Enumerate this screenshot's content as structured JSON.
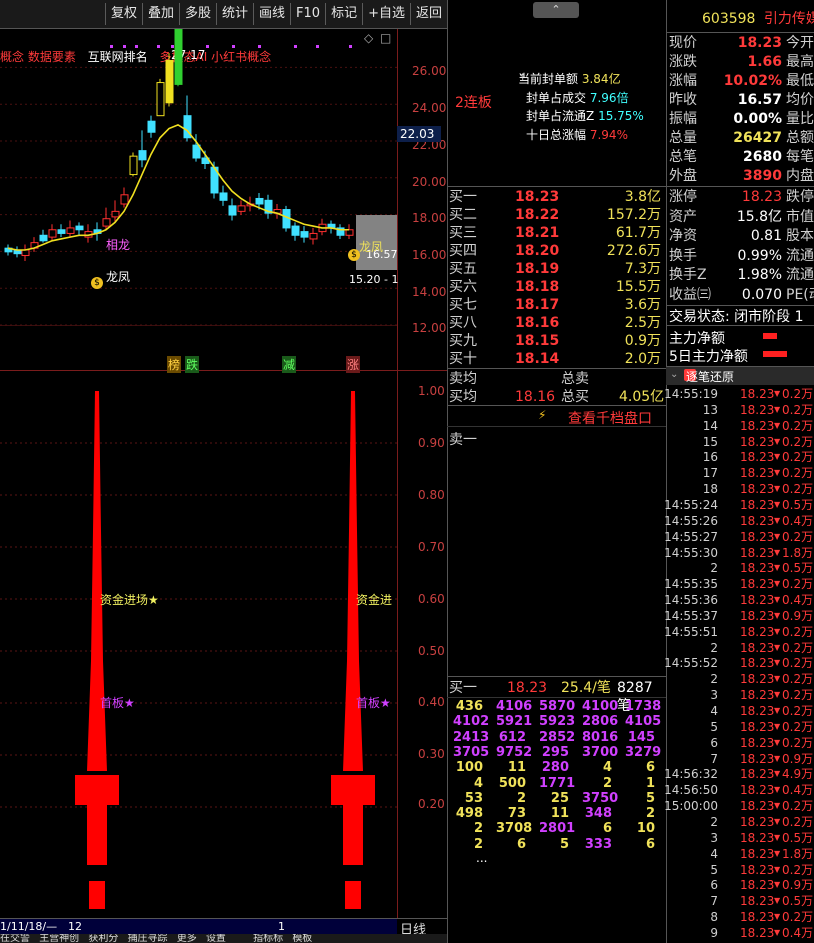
{
  "toolbar": {
    "buttons": [
      "复权",
      "叠加",
      "多股",
      "统计",
      "画线",
      "F10",
      "标记",
      "+自选",
      "返回"
    ]
  },
  "kline": {
    "header_left": "概念 数据要素",
    "header_mid": "互联网排名",
    "header_right": "多模态AI 小红书概念",
    "max_label": "27.17",
    "yticks": [
      "26.00",
      "24.00",
      "22.00",
      "20.00",
      "18.00",
      "16.00",
      "14.00",
      "12.00"
    ],
    "current_price_box": "22.03",
    "low_label": "15.20 - 1",
    "right_label": "16.57",
    "annotation_longfeng": "龙凤",
    "annotation_xianghu": "相龙",
    "annotation_longfeng2": "龙凤",
    "tags": [
      "榜",
      "跌",
      "减",
      "涨"
    ]
  },
  "indicator": {
    "yticks": [
      "1.00",
      "0.90",
      "0.80",
      "0.70",
      "0.60",
      "0.50",
      "0.40",
      "0.30",
      "0.20"
    ],
    "label_fund": "资金进场★",
    "label_fund2": "资金进",
    "label_first": "首板★",
    "label_first2": "首板★"
  },
  "bottom": {
    "date": "1/11/18/—",
    "marker12": "12",
    "marker1": "1",
    "day_label": "日线",
    "tabs": [
      "在交警",
      "主营神创",
      "获利分",
      "捕庄寻踪",
      "更多",
      "设置",
      "指标标",
      "模板"
    ]
  },
  "board": {
    "lianban": "2连板",
    "seal_amount_label": "当前封单额",
    "seal_amount": "3.84亿",
    "seal_ratio_label": "封单占成交",
    "seal_ratio": "7.96倍",
    "seal_float_label": "封单占流通Z",
    "seal_float": "15.75%",
    "ten_day_label": "十日总涨幅",
    "ten_day": "7.94%"
  },
  "stock": {
    "code": "603598",
    "name": "引力传媒",
    "fields": [
      {
        "l": "现价",
        "v": "18.23",
        "c": "r",
        "t": "今开"
      },
      {
        "l": "涨跌",
        "v": "1.66",
        "c": "r",
        "t": "最高"
      },
      {
        "l": "涨幅",
        "v": "10.02%",
        "c": "r",
        "t": "最低"
      },
      {
        "l": "昨收",
        "v": "16.57",
        "c": "w",
        "t": "均价"
      },
      {
        "l": "振幅",
        "v": "0.00%",
        "c": "w",
        "t": "量比"
      },
      {
        "l": "总量",
        "v": "26427",
        "c": "y",
        "t": "总额"
      },
      {
        "l": "总笔",
        "v": "2680",
        "c": "w",
        "t": "每笔"
      },
      {
        "l": "外盘",
        "v": "3890",
        "c": "r",
        "t": "内盘"
      }
    ],
    "fields2": [
      {
        "l": "涨停",
        "v": "18.23",
        "c": "r",
        "t": "跌停"
      },
      {
        "l": "资产",
        "v": "15.8亿",
        "c": "w",
        "t": "市值"
      },
      {
        "l": "净资",
        "v": "0.81",
        "c": "w",
        "t": "股本"
      },
      {
        "l": "换手",
        "v": "0.99%",
        "c": "w",
        "t": "流通"
      },
      {
        "l": "换手Z",
        "v": "1.98%",
        "c": "w",
        "t": "流通"
      },
      {
        "l": "收益㈢",
        "v": "0.070",
        "c": "w",
        "t": "PE(动"
      }
    ],
    "trade_status": "交易状态: 闭市阶段 1",
    "main_net": "主力净额",
    "main_net5": "5日主力净额"
  },
  "orderbook": {
    "buys": [
      {
        "l": "买一",
        "p": "18.23",
        "v": "3.8亿"
      },
      {
        "l": "买二",
        "p": "18.22",
        "v": "157.2万"
      },
      {
        "l": "买三",
        "p": "18.21",
        "v": "61.7万"
      },
      {
        "l": "买四",
        "p": "18.20",
        "v": "272.6万"
      },
      {
        "l": "买五",
        "p": "18.19",
        "v": "7.3万"
      },
      {
        "l": "买六",
        "p": "18.18",
        "v": "15.5万"
      },
      {
        "l": "买七",
        "p": "18.17",
        "v": "3.6万"
      },
      {
        "l": "买八",
        "p": "18.16",
        "v": "2.5万"
      },
      {
        "l": "买九",
        "p": "18.15",
        "v": "0.9万"
      },
      {
        "l": "买十",
        "p": "18.14",
        "v": "2.0万"
      }
    ],
    "sell_avg_label": "卖均",
    "sell_total_label": "总卖",
    "buy_avg_label": "买均",
    "buy_avg": "18.16",
    "buy_total_label": "总买",
    "buy_total": "4.05亿",
    "view_depth": "查看千档盘口",
    "sell1_label": "卖一",
    "queue_label": "买一",
    "queue_price": "18.23",
    "queue_avg": "25.4/笔",
    "queue_count": "8287笔",
    "queue": [
      [
        "436",
        "4106",
        "5870",
        "4100",
        "1738"
      ],
      [
        "4102",
        "5921",
        "5923",
        "2806",
        "4105"
      ],
      [
        "2413",
        "612",
        "2852",
        "8016",
        "145"
      ],
      [
        "3705",
        "9752",
        "295",
        "3700",
        "3279"
      ],
      [
        "100",
        "11",
        "280",
        "4",
        "6"
      ],
      [
        "4",
        "500",
        "1771",
        "2",
        "1"
      ],
      [
        "53",
        "2",
        "25",
        "3750",
        "5"
      ],
      [
        "498",
        "73",
        "11",
        "348",
        "2"
      ],
      [
        "2",
        "3708",
        "2801",
        "6",
        "10"
      ],
      [
        "2",
        "6",
        "5",
        "333",
        "6"
      ]
    ],
    "queue_more": "..."
  },
  "ticks": {
    "title": "逐笔还原",
    "rows": [
      {
        "t": "14:55:19",
        "p": "18.23",
        "v": "0.2万"
      },
      {
        "t": "13",
        "p": "18.23",
        "v": "0.2万"
      },
      {
        "t": "14",
        "p": "18.23",
        "v": "0.2万"
      },
      {
        "t": "15",
        "p": "18.23",
        "v": "0.2万"
      },
      {
        "t": "16",
        "p": "18.23",
        "v": "0.2万"
      },
      {
        "t": "17",
        "p": "18.23",
        "v": "0.2万"
      },
      {
        "t": "18",
        "p": "18.23",
        "v": "0.2万"
      },
      {
        "t": "14:55:24",
        "p": "18.23",
        "v": "0.5万"
      },
      {
        "t": "14:55:26",
        "p": "18.23",
        "v": "0.4万"
      },
      {
        "t": "14:55:27",
        "p": "18.23",
        "v": "0.2万"
      },
      {
        "t": "14:55:30",
        "p": "18.23",
        "v": "1.8万"
      },
      {
        "t": "2",
        "p": "18.23",
        "v": "0.5万"
      },
      {
        "t": "14:55:35",
        "p": "18.23",
        "v": "0.2万"
      },
      {
        "t": "14:55:36",
        "p": "18.23",
        "v": "0.4万"
      },
      {
        "t": "14:55:37",
        "p": "18.23",
        "v": "0.9万"
      },
      {
        "t": "14:55:51",
        "p": "18.23",
        "v": "0.2万"
      },
      {
        "t": "2",
        "p": "18.23",
        "v": "0.2万"
      },
      {
        "t": "14:55:52",
        "p": "18.23",
        "v": "0.2万"
      },
      {
        "t": "2",
        "p": "18.23",
        "v": "0.2万"
      },
      {
        "t": "3",
        "p": "18.23",
        "v": "0.2万"
      },
      {
        "t": "4",
        "p": "18.23",
        "v": "0.2万"
      },
      {
        "t": "5",
        "p": "18.23",
        "v": "0.2万"
      },
      {
        "t": "6",
        "p": "18.23",
        "v": "0.2万"
      },
      {
        "t": "7",
        "p": "18.23",
        "v": "0.9万"
      },
      {
        "t": "14:56:32",
        "p": "18.23",
        "v": "4.9万"
      },
      {
        "t": "14:56:50",
        "p": "18.23",
        "v": "0.4万"
      },
      {
        "t": "15:00:00",
        "p": "18.23",
        "v": "0.2万"
      },
      {
        "t": "2",
        "p": "18.23",
        "v": "0.2万"
      },
      {
        "t": "3",
        "p": "18.23",
        "v": "0.5万"
      },
      {
        "t": "4",
        "p": "18.23",
        "v": "1.8万"
      },
      {
        "t": "5",
        "p": "18.23",
        "v": "0.2万"
      },
      {
        "t": "6",
        "p": "18.23",
        "v": "0.9万"
      },
      {
        "t": "7",
        "p": "18.23",
        "v": "0.5万"
      },
      {
        "t": "8",
        "p": "18.23",
        "v": "0.2万"
      },
      {
        "t": "9",
        "p": "18.23",
        "v": "0.4万"
      }
    ]
  },
  "colors": {
    "up": "#ff3a3a",
    "down": "#40ffff",
    "accent": "#f0e25a",
    "grid": "#7a1c1c"
  }
}
